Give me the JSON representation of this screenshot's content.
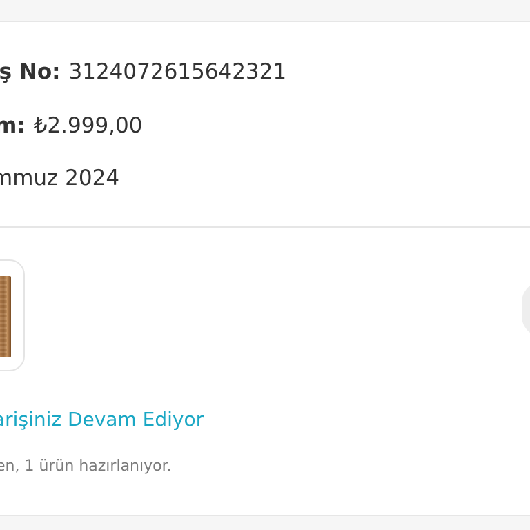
{
  "summary": {
    "order_no_label": "iş No:",
    "order_no_value": "3124072615642321",
    "total_label": "m:",
    "total_value": "₺2.999,00",
    "date_value": "mmuz 2024"
  },
  "order": {
    "status_title": "arişiniz Devam Ediyor",
    "status_detail": "en, 1 ürün hazırlanıyor."
  },
  "colors": {
    "accent": "#1aa7c4",
    "text": "#333333",
    "muted": "#7a7a7a"
  }
}
